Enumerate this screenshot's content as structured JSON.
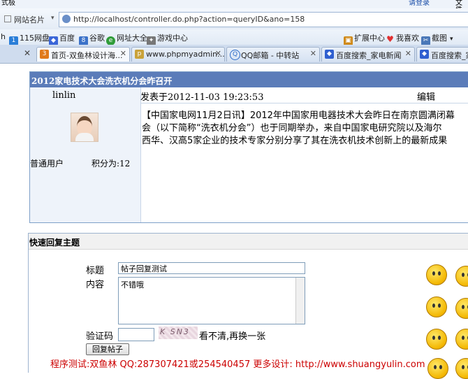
{
  "browser": {
    "top_left_text": "式极",
    "top_right_text": "请登录",
    "top_far_right": "文件",
    "address_label": "网站名片",
    "address_url": "http://localhost/controller.do.php?action=queryID&ano=158",
    "bookmarks_left": [
      "h",
      "115网盘",
      "百度",
      "谷歌",
      "网址大全",
      "游戏中心"
    ],
    "bookmarks_right": [
      "扩展中心",
      "我喜欢",
      "截图"
    ],
    "tabs": [
      {
        "title": "首页-双鱼林设计海..."
      },
      {
        "title": "www.phpmyadmin...."
      },
      {
        "title": "QQ邮箱 - 中转站"
      },
      {
        "title": "百度搜索_家电新闻"
      },
      {
        "title": "百度搜索_家电"
      }
    ]
  },
  "post": {
    "title": "2012家电技术大会洗衣机分会昨召开",
    "author": "linlin",
    "posted_at": "发表于2012-11-03 19:23:53",
    "edit_label": "编辑",
    "user_role": "普通用户",
    "points": "积分为:12",
    "body_lines": [
      "【中国家电网11月2日讯】2012年中国家用电器技术大会昨日在南京圆满闭幕",
      "会（以下简称“洗衣机分会”）也于同期举办，来自中国家电研究院以及海尔",
      "西华、汉高5家企业的技术专家分别分享了其在洗衣机技术创新上的最新成果"
    ]
  },
  "reply": {
    "heading": "快速回复主题",
    "title_label": "标题",
    "title_value": "帖子回复测试",
    "content_label": "内容",
    "content_value": "不错哦",
    "captcha_label": "验证码",
    "captcha_value": "",
    "captcha_image_text": "K SN3",
    "captcha_refresh": "看不清,再换一张",
    "submit_label": "回复帖子"
  },
  "footer": {
    "credit": "程序测试:双鱼林 QQ:287307421或254540457 更多设计: http://www.shuangyulin.com"
  },
  "colors": {
    "title_bar": "#5b7cb9",
    "footer_text": "#cc0000"
  }
}
